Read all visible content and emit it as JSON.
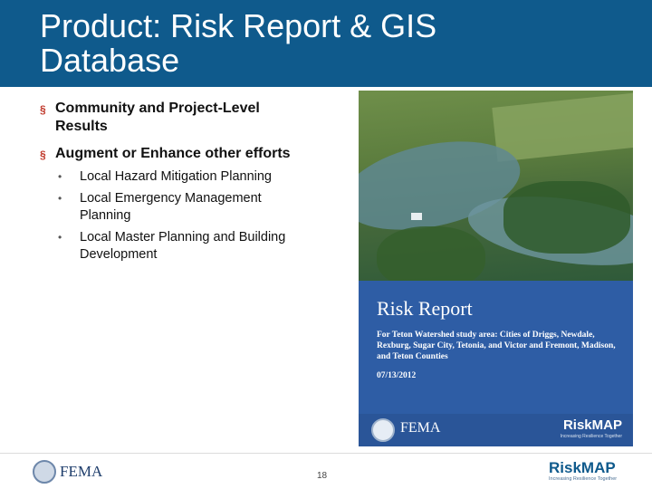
{
  "slide": {
    "title_line1": "Product: Risk Report & GIS",
    "title_line2": "Database",
    "bullets": [
      {
        "text": "Community and Project-Level Results"
      },
      {
        "text": "Augment or Enhance other efforts"
      }
    ],
    "sub_bullets": [
      {
        "text": "Local Hazard Mitigation Planning"
      },
      {
        "text": "Local Emergency Management Planning"
      },
      {
        "text": "Local Master Planning and Building Development"
      }
    ],
    "bullet_marker": "§",
    "sub_marker": "•"
  },
  "report_cover": {
    "title": "Risk Report",
    "subtitle": "For Teton Watershed study area: Cities of Driggs, Newdale, Rexburg, Sugar City, Tetonia, and Victor and Fremont, Madison, and Teton Counties",
    "date": "07/13/2012",
    "agency": "FEMA",
    "brand": "RiskMAP",
    "tagline": "Increasing Resilience Together"
  },
  "footer": {
    "agency": "FEMA",
    "page_number": "18",
    "brand_risk": "Risk",
    "brand_map": "MAP",
    "tagline": "Increasing Resilience Together"
  },
  "colors": {
    "title_bar": "#0f5a8c",
    "bullet_accent": "#c0392b",
    "cover_blue": "#2e5da5"
  }
}
